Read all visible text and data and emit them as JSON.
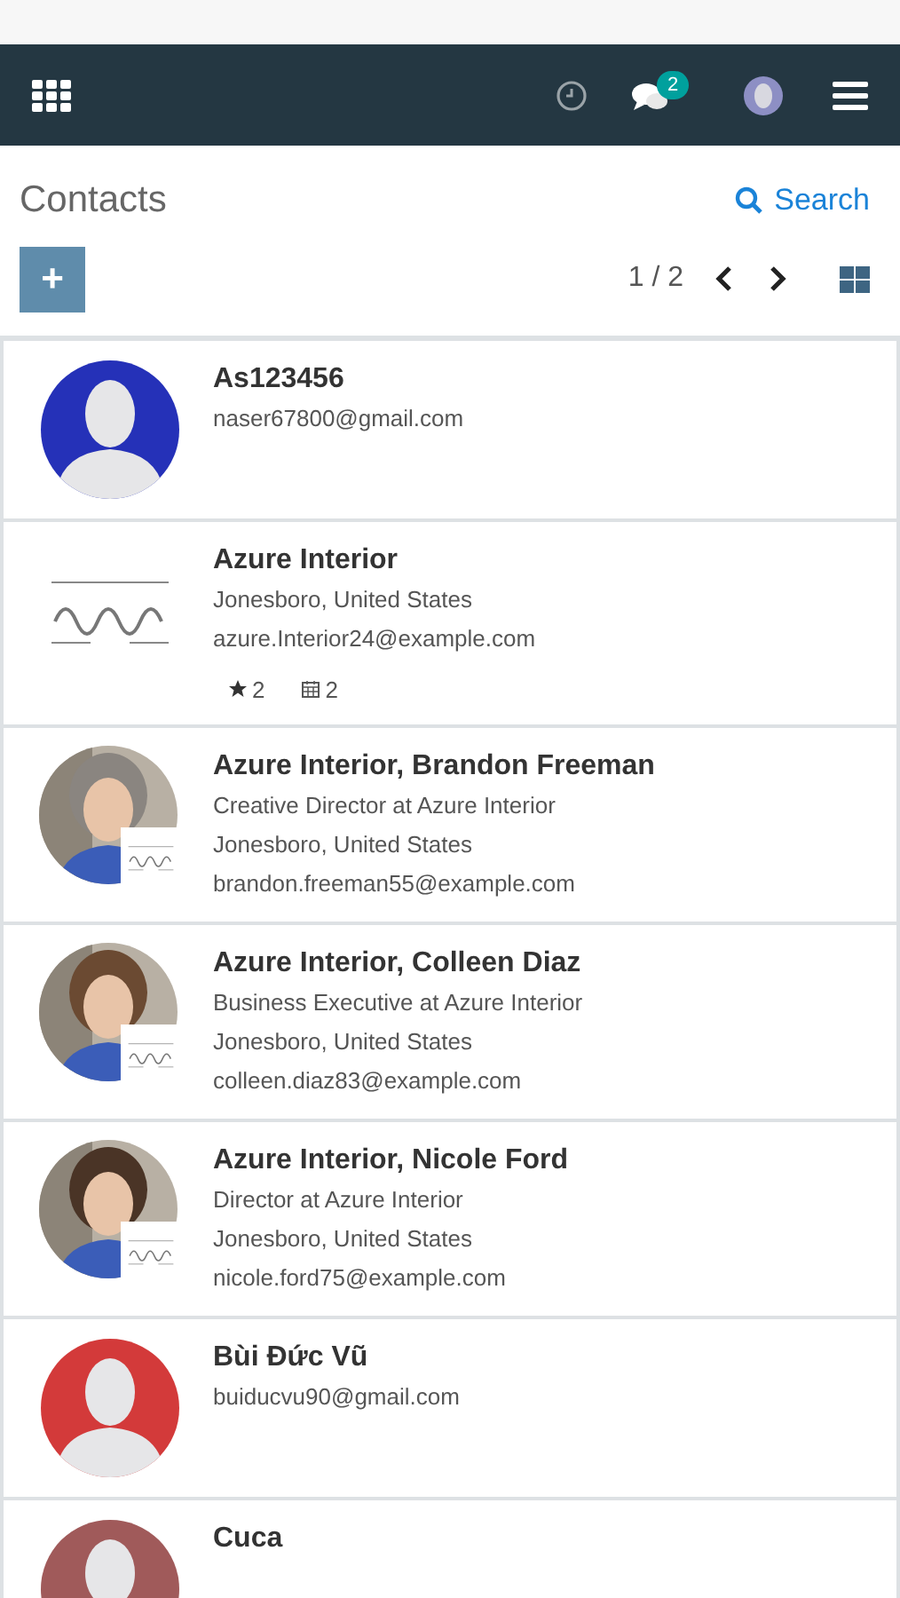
{
  "navbar": {
    "messages_badge": "2"
  },
  "header": {
    "title": "Contacts",
    "search_label": "Search"
  },
  "toolbar": {
    "add_label": "+",
    "pager": "1 / 2"
  },
  "contacts": [
    {
      "name": "As123456",
      "lines": [
        "naser67800@gmail.com"
      ],
      "avatar": {
        "kind": "placeholder",
        "color": "#2531b8"
      }
    },
    {
      "name": "Azure Interior",
      "lines": [
        "Jonesboro, United States",
        "azure.Interior24@example.com"
      ],
      "avatar": {
        "kind": "logo"
      },
      "counters": [
        {
          "kind": "star",
          "value": "2"
        },
        {
          "kind": "calendar",
          "value": "2"
        }
      ]
    },
    {
      "name": "Azure Interior, Brandon Freeman",
      "lines": [
        "Creative Director at Azure Interior",
        "Jonesboro, United States",
        "brandon.freeman55@example.com"
      ]
    },
    {
      "name": "Azure Interior, Colleen Diaz",
      "lines": [
        "Business Executive at Azure Interior",
        "Jonesboro, United States",
        "colleen.diaz83@example.com"
      ]
    },
    {
      "name": "Azure Interior, Nicole Ford",
      "lines": [
        "Director at Azure Interior",
        "Jonesboro, United States",
        "nicole.ford75@example.com"
      ]
    },
    {
      "name": "Bùi Đức Vũ",
      "lines": [
        "buiducvu90@gmail.com"
      ],
      "avatar": {
        "kind": "placeholder",
        "color": "#d33a3a"
      }
    },
    {
      "name": "Cuca",
      "avatar": {
        "kind": "placeholder",
        "color": "#a05a5a"
      }
    }
  ]
}
